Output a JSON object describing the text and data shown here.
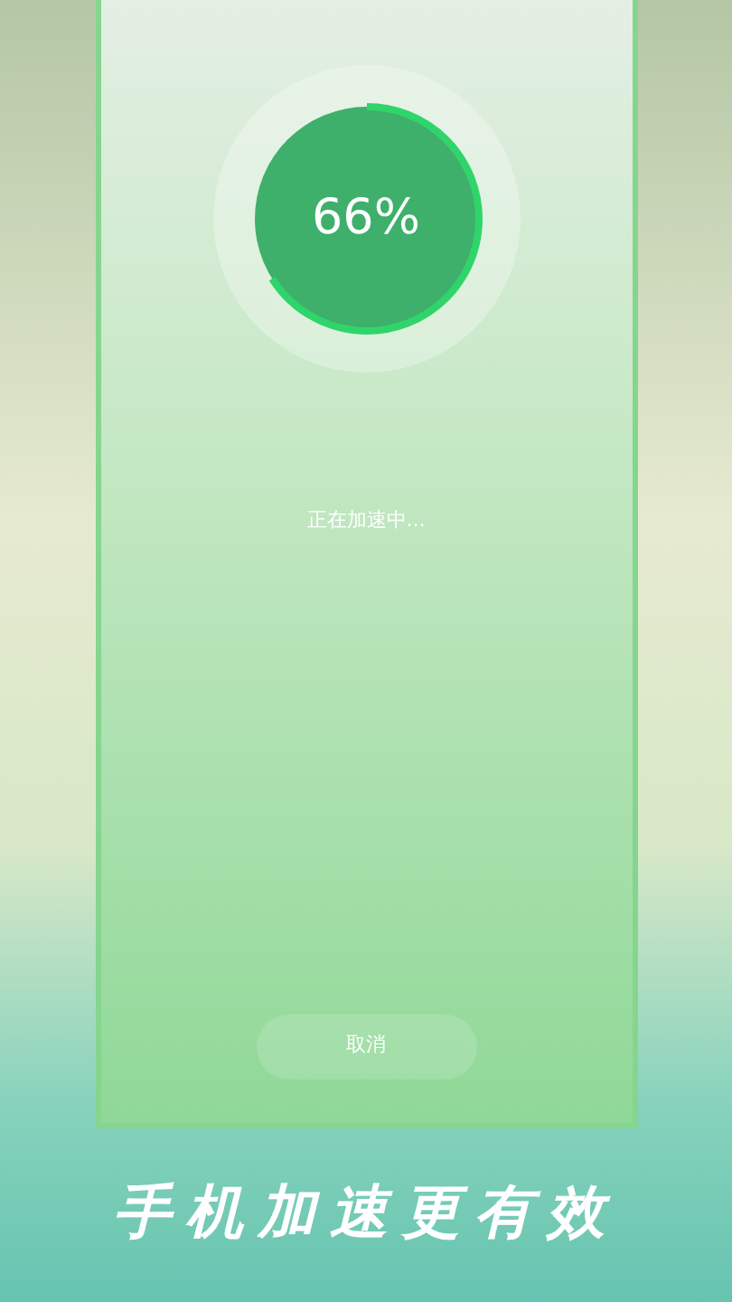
{
  "progress": {
    "reading": "66%",
    "level": 0.66
  },
  "status": "正在加速中...",
  "cancel_button": "取消",
  "slogan": "手机加速更有效"
}
